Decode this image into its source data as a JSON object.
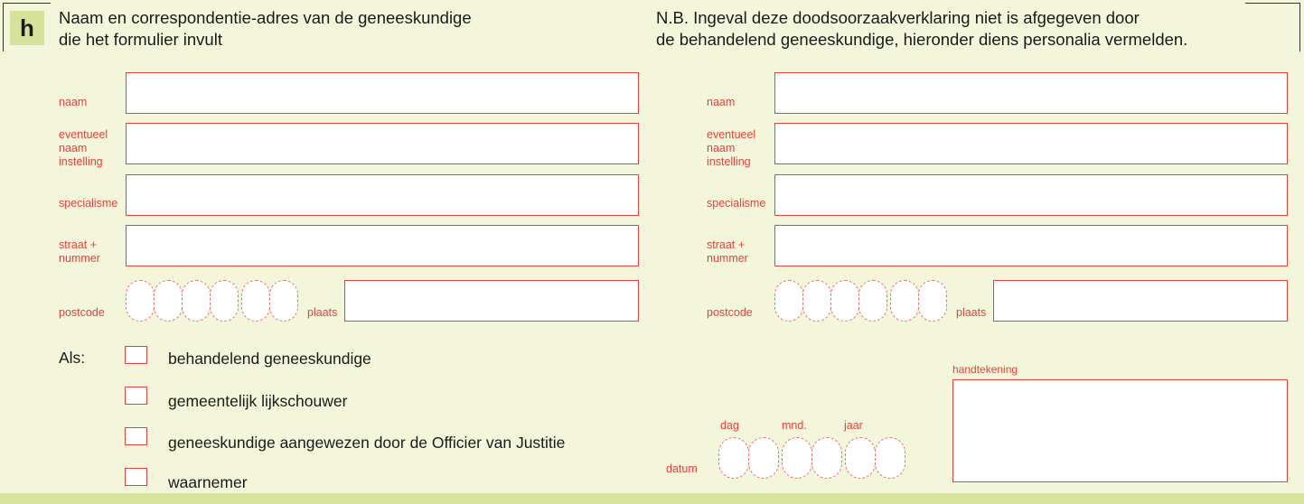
{
  "section": {
    "badge": "h",
    "heading_left": [
      "Naam en correspondentie-adres van de geneeskundige",
      "die het formulier invult"
    ],
    "heading_right": [
      "N.B. Ingeval deze doodsoorzaakverklaring niet is afgegeven door",
      "de behandelend geneeskundige, hieronder diens personalia vermelden."
    ]
  },
  "left_form": {
    "fields": [
      {
        "label": [
          "naam"
        ],
        "value": ""
      },
      {
        "label": [
          "eventueel",
          "naam",
          "instelling"
        ],
        "value": ""
      },
      {
        "label": [
          "specialisme"
        ],
        "value": ""
      },
      {
        "label": [
          "straat +",
          "nummer"
        ],
        "value": ""
      }
    ],
    "postcode_label": "postcode",
    "postcode_value": "",
    "plaats_label": "plaats",
    "plaats_value": ""
  },
  "right_form": {
    "fields": [
      {
        "label": [
          "naam"
        ],
        "value": ""
      },
      {
        "label": [
          "eventueel",
          "naam",
          "instelling"
        ],
        "value": ""
      },
      {
        "label": [
          "specialisme"
        ],
        "value": ""
      },
      {
        "label": [
          "straat +",
          "nummer"
        ],
        "value": ""
      }
    ],
    "postcode_label": "postcode",
    "postcode_value": "",
    "plaats_label": "plaats",
    "plaats_value": ""
  },
  "role": {
    "label": "Als:",
    "options": [
      {
        "label": "behandelend geneeskundige",
        "checked": false
      },
      {
        "label": "gemeentelijk lijkschouwer",
        "checked": false
      },
      {
        "label": "geneeskundige aangewezen door de Officier van Justitie",
        "checked": false
      },
      {
        "label": "waarnemer",
        "checked": false
      }
    ]
  },
  "date": {
    "label": "datum",
    "day_label": "dag",
    "month_label": "mnd.",
    "year_label": "jaar",
    "value": ""
  },
  "signature": {
    "label": "handtekening"
  },
  "colors": {
    "background": "#f4f6dc",
    "accent_red": "#e8403a",
    "badge_green": "#d6e29a",
    "band_green": "#d8e49a"
  }
}
